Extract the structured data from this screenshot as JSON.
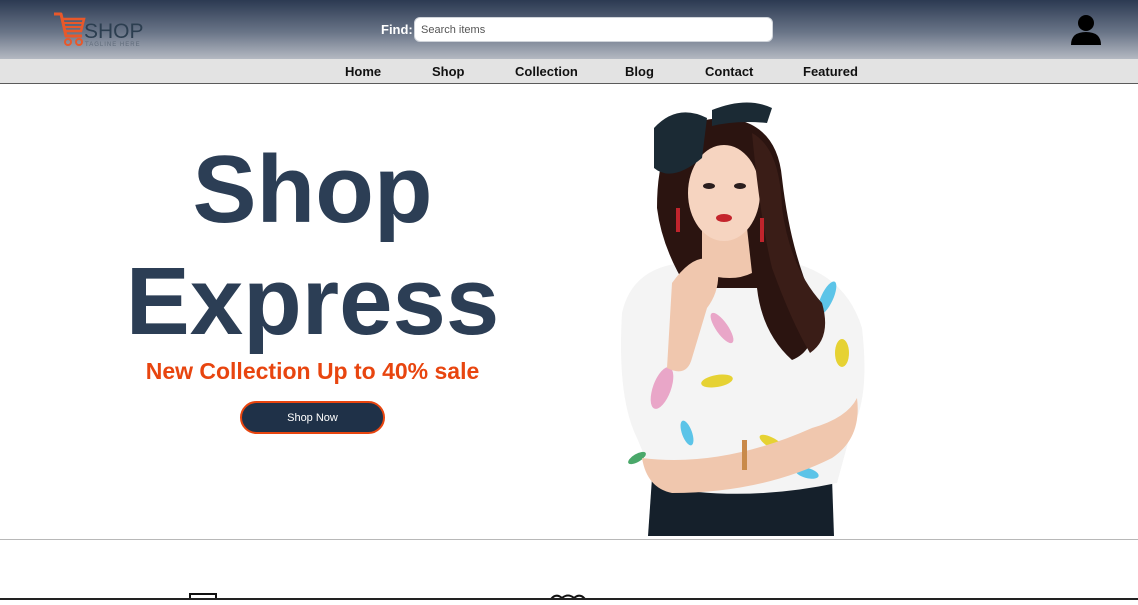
{
  "header": {
    "logo_text": "SHOP",
    "logo_tagline": "TAGLINE HERE",
    "find_label": "Find:",
    "search_placeholder": "Search items",
    "search_value": ""
  },
  "nav": {
    "items": [
      "Home",
      "Shop",
      "Collection",
      "Blog",
      "Contact",
      "Featured"
    ]
  },
  "hero": {
    "title_line1": "Shop",
    "title_line2": "Express",
    "subtitle": "New Collection Up to 40% sale",
    "cta_label": "Shop Now"
  },
  "colors": {
    "header_dark": "#2c3a52",
    "title": "#2c3e55",
    "accent": "#e8450f",
    "button_bg": "#1f3148",
    "nav_bg": "#e3e3e3"
  },
  "icons": {
    "logo": "shopping-cart-icon",
    "account": "user-icon",
    "hero_image": "woman-model-photo"
  }
}
